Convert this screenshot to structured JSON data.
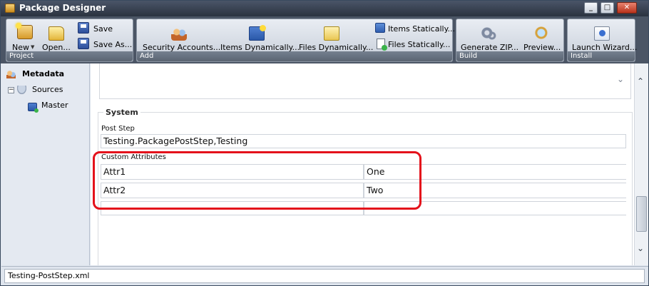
{
  "window": {
    "title": "Package Designer"
  },
  "ribbon": {
    "groups": {
      "project": {
        "label": "Project",
        "new": "New",
        "open": "Open...",
        "save": "Save",
        "save_as": "Save As..."
      },
      "add": {
        "label": "Add",
        "security_accounts": "Security Accounts...",
        "items_dynamically": "Items Dynamically...",
        "files_dynamically": "Files Dynamically...",
        "items_statically": "Items Statically...",
        "files_statically": "Files Statically..."
      },
      "build": {
        "label": "Build",
        "generate_zip": "Generate ZIP...",
        "preview": "Preview..."
      },
      "install": {
        "label": "Install",
        "launch_wizard": "Launch Wizard..."
      }
    }
  },
  "tree": {
    "metadata": "Metadata",
    "sources": "Sources",
    "master": "Master",
    "toggle_symbol": "−"
  },
  "system": {
    "legend": "System",
    "post_step_label": "Post Step",
    "post_step_value": "Testing.PackagePostStep,Testing",
    "custom_attributes_label": "Custom Attributes",
    "attributes": [
      {
        "key": "Attr1",
        "value": "One"
      },
      {
        "key": "Attr2",
        "value": "Two"
      },
      {
        "key": "",
        "value": ""
      }
    ]
  },
  "status": {
    "filename": "Testing-PostStep.xml"
  },
  "colors": {
    "highlight": "#e4111b",
    "titlebar": "#2b3340",
    "ribbon": "#4b5565"
  }
}
